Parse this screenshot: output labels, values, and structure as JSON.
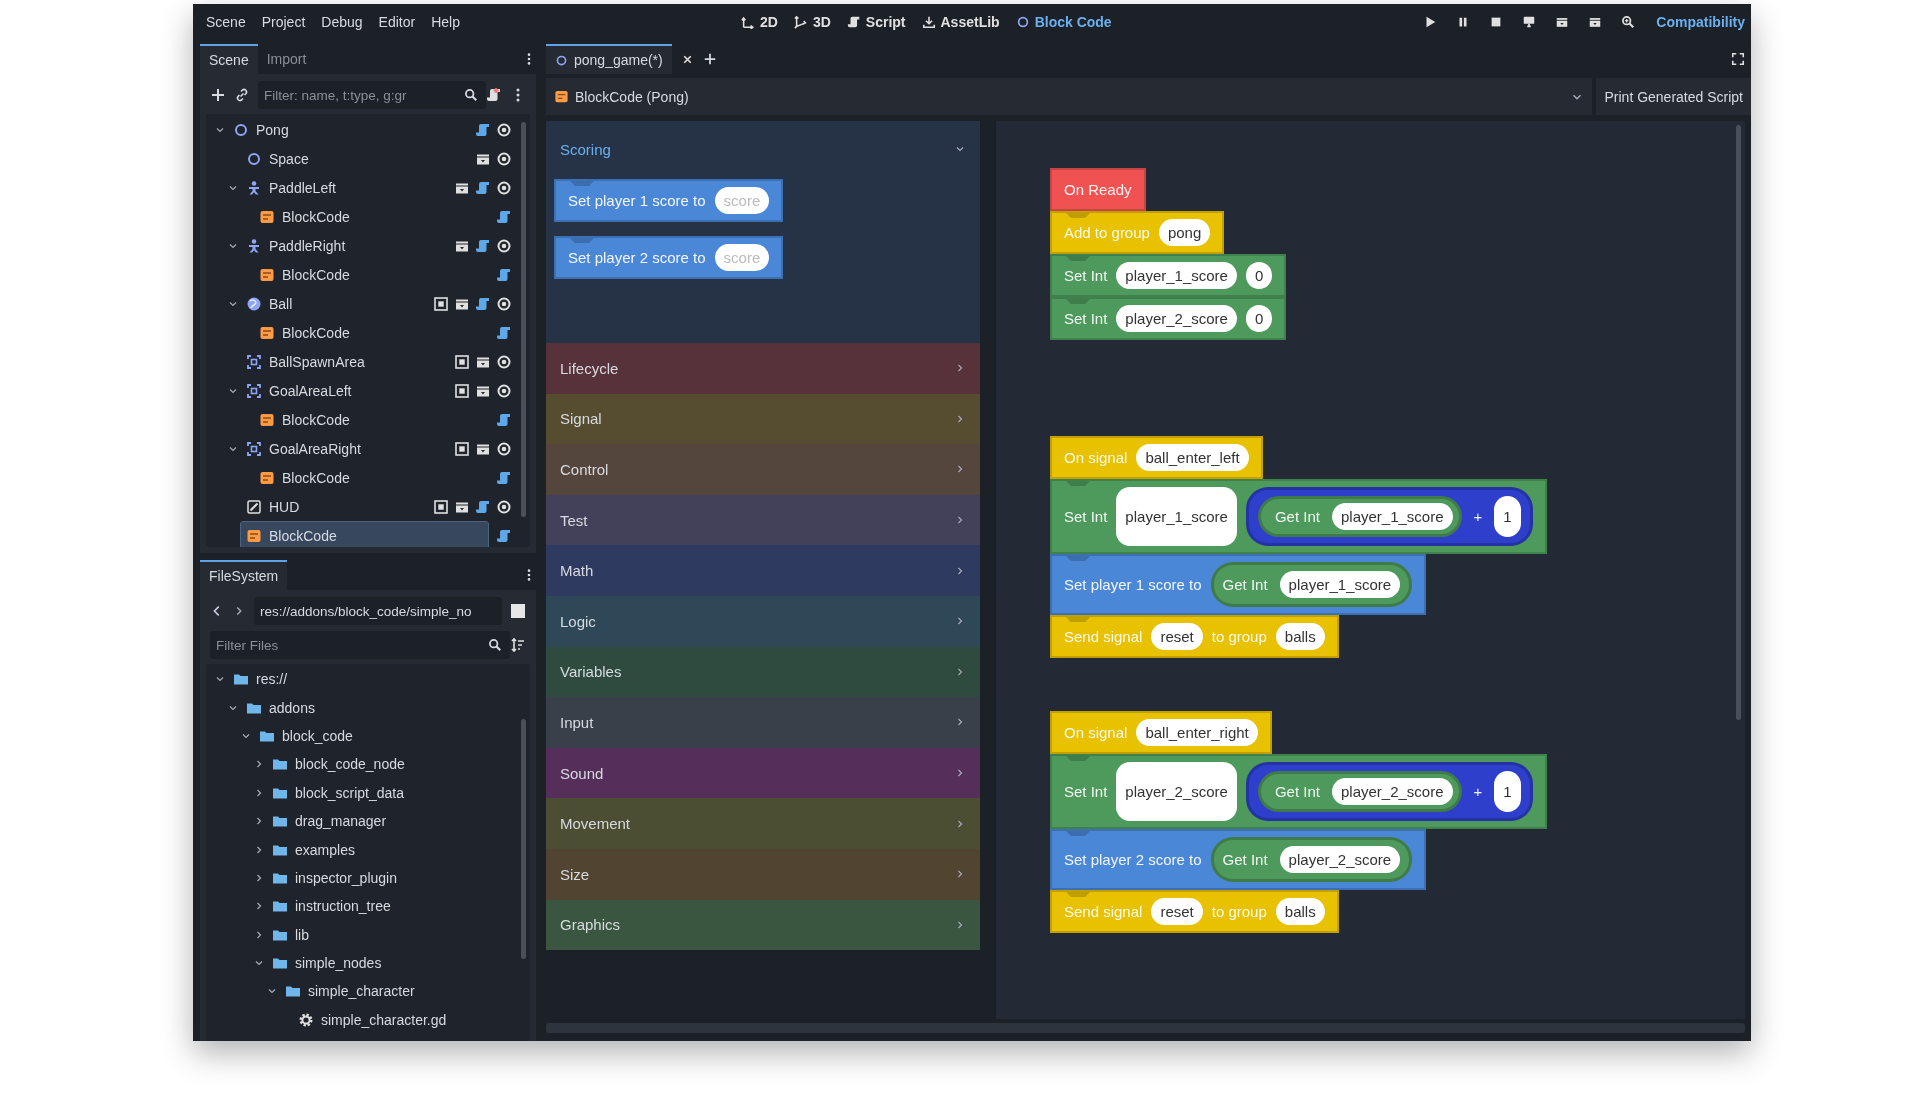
{
  "menu": [
    "Scene",
    "Project",
    "Debug",
    "Editor",
    "Help"
  ],
  "workspaces": [
    {
      "label": "2D",
      "selected": false
    },
    {
      "label": "3D",
      "selected": false
    },
    {
      "label": "Script",
      "selected": false
    },
    {
      "label": "AssetLib",
      "selected": false
    },
    {
      "label": "Block Code",
      "selected": true
    }
  ],
  "renderer": "Compatibility",
  "scene_dock": {
    "tabs": [
      {
        "label": "Scene",
        "selected": true
      },
      {
        "label": "Import",
        "selected": false
      }
    ],
    "filter": {
      "placeholder": "Filter: name, t:type, g:gr"
    },
    "tree": [
      {
        "name": "Pong",
        "kind": "node",
        "script": true,
        "visible": true,
        "expanded": true,
        "selected": false,
        "children": [
          {
            "name": "Space",
            "kind": "node",
            "groups": true,
            "visible": true,
            "selected": false
          },
          {
            "name": "PaddleLeft",
            "kind": "character",
            "groups": true,
            "script": true,
            "visible": true,
            "expanded": true,
            "selected": false,
            "children": [
              {
                "name": "BlockCode",
                "kind": "blockcode",
                "script": true,
                "selected": false
              }
            ]
          },
          {
            "name": "PaddleRight",
            "kind": "character",
            "groups": true,
            "script": true,
            "visible": true,
            "expanded": true,
            "selected": false,
            "children": [
              {
                "name": "BlockCode",
                "kind": "blockcode",
                "script": true,
                "selected": false
              }
            ]
          },
          {
            "name": "Ball",
            "kind": "rigidbody",
            "signals": true,
            "groups": true,
            "script": true,
            "visible": true,
            "expanded": true,
            "selected": false,
            "children": [
              {
                "name": "BlockCode",
                "kind": "blockcode",
                "script": true,
                "selected": false
              }
            ]
          },
          {
            "name": "BallSpawnArea",
            "kind": "area",
            "signals": true,
            "groups": true,
            "visible": true,
            "selected": false
          },
          {
            "name": "GoalAreaLeft",
            "kind": "area",
            "signals": true,
            "groups": true,
            "visible": true,
            "expanded": true,
            "selected": false,
            "children": [
              {
                "name": "BlockCode",
                "kind": "blockcode",
                "script": true,
                "selected": false
              }
            ]
          },
          {
            "name": "GoalAreaRight",
            "kind": "area",
            "signals": true,
            "groups": true,
            "visible": true,
            "expanded": true,
            "selected": false,
            "children": [
              {
                "name": "BlockCode",
                "kind": "blockcode",
                "script": true,
                "selected": false
              }
            ]
          },
          {
            "name": "HUD",
            "kind": "control",
            "signals": true,
            "groups": true,
            "script": true,
            "visible": true,
            "selected": false
          },
          {
            "name": "BlockCode",
            "kind": "blockcode",
            "script": true,
            "selected": true
          }
        ]
      }
    ]
  },
  "filesystem": {
    "tabs": [
      {
        "label": "FileSystem",
        "selected": true
      }
    ],
    "path": "res://addons/block_code/simple_no",
    "filter": {
      "placeholder": "Filter Files"
    },
    "tree": [
      {
        "name": "res://",
        "kind": "folder",
        "expanded": true,
        "children": [
          {
            "name": "addons",
            "kind": "folder",
            "expanded": true,
            "children": [
              {
                "name": "block_code",
                "kind": "folder",
                "expanded": true,
                "children": [
                  {
                    "name": "block_code_node",
                    "kind": "folder",
                    "expanded": false
                  },
                  {
                    "name": "block_script_data",
                    "kind": "folder",
                    "expanded": false
                  },
                  {
                    "name": "drag_manager",
                    "kind": "folder",
                    "expanded": false
                  },
                  {
                    "name": "examples",
                    "kind": "folder",
                    "expanded": false
                  },
                  {
                    "name": "inspector_plugin",
                    "kind": "folder",
                    "expanded": false
                  },
                  {
                    "name": "instruction_tree",
                    "kind": "folder",
                    "expanded": false
                  },
                  {
                    "name": "lib",
                    "kind": "folder",
                    "expanded": false
                  },
                  {
                    "name": "simple_nodes",
                    "kind": "folder",
                    "expanded": true,
                    "children": [
                      {
                        "name": "simple_character",
                        "kind": "folder",
                        "expanded": true,
                        "children": [
                          {
                            "name": "simple_character.gd",
                            "kind": "file"
                          }
                        ]
                      }
                    ]
                  }
                ]
              }
            ]
          }
        ]
      }
    ]
  },
  "editor": {
    "tabs": [
      {
        "label": "pong_game(*)",
        "selected": true
      }
    ],
    "node_selector": "BlockCode (Pong)",
    "print_button": "Print Generated Script",
    "palette": {
      "categories": [
        {
          "name": "Scoring",
          "color": "#263246",
          "expanded": true,
          "blocks": [
            {
              "kind": "statement",
              "color": "#4a87d6",
              "parts": [
                {
                  "kind": "text",
                  "text": "Set player 1 score to"
                },
                {
                  "kind": "value",
                  "placeholder": "score"
                }
              ]
            },
            {
              "kind": "statement",
              "color": "#4a87d6",
              "parts": [
                {
                  "kind": "text",
                  "text": "Set player 2 score to"
                },
                {
                  "kind": "value",
                  "placeholder": "score"
                }
              ]
            }
          ]
        },
        {
          "name": "Lifecycle",
          "color": "#58323a",
          "expanded": false
        },
        {
          "name": "Signal",
          "color": "#564c30",
          "expanded": false
        },
        {
          "name": "Control",
          "color": "#54453d",
          "expanded": false
        },
        {
          "name": "Test",
          "color": "#43415a",
          "expanded": false
        },
        {
          "name": "Math",
          "color": "#2e3a60",
          "expanded": false
        },
        {
          "name": "Logic",
          "color": "#2e4857",
          "expanded": false
        },
        {
          "name": "Variables",
          "color": "#2f4a3e",
          "expanded": false
        },
        {
          "name": "Input",
          "color": "#3a4049",
          "expanded": false
        },
        {
          "name": "Sound",
          "color": "#552f5a",
          "expanded": false
        },
        {
          "name": "Movement",
          "color": "#4b4e32",
          "expanded": false
        },
        {
          "name": "Size",
          "color": "#514532",
          "expanded": false
        },
        {
          "name": "Graphics",
          "color": "#3a5640",
          "expanded": false
        }
      ]
    },
    "canvas": {
      "stacks": [
        {
          "blocks": [
            {
              "kind": "hat",
              "color": "#f05252",
              "parts": [
                {
                  "kind": "text",
                  "text": "On Ready"
                }
              ]
            },
            {
              "kind": "statement",
              "color": "#e8c100",
              "parts": [
                {
                  "kind": "text",
                  "text": "Add to group"
                },
                {
                  "kind": "value",
                  "text": "pong"
                }
              ]
            },
            {
              "kind": "statement",
              "color": "#4e9a5c",
              "parts": [
                {
                  "kind": "text",
                  "text": "Set Int"
                },
                {
                  "kind": "value",
                  "text": "player_1_score"
                },
                {
                  "kind": "value",
                  "text": "0"
                }
              ]
            },
            {
              "kind": "statement",
              "color": "#4e9a5c",
              "parts": [
                {
                  "kind": "text",
                  "text": "Set Int"
                },
                {
                  "kind": "value",
                  "text": "player_2_score"
                },
                {
                  "kind": "value",
                  "text": "0"
                }
              ]
            }
          ]
        },
        {
          "blocks": [
            {
              "kind": "hat",
              "color": "#e8c100",
              "parts": [
                {
                  "kind": "text",
                  "text": "On signal"
                },
                {
                  "kind": "value",
                  "text": "ball_enter_left"
                }
              ]
            },
            {
              "kind": "statement",
              "color": "#4e9a5c",
              "parts": [
                {
                  "kind": "text",
                  "text": "Set Int"
                },
                {
                  "kind": "value",
                  "text": "player_1_score"
                },
                {
                  "kind": "expr",
                  "color": "#2e3fcc",
                  "parts": [
                    {
                      "kind": "expr",
                      "color": "#4e9a5c",
                      "parts": [
                        {
                          "kind": "text",
                          "text": "Get Int"
                        },
                        {
                          "kind": "value",
                          "text": "player_1_score"
                        }
                      ]
                    },
                    {
                      "kind": "text",
                      "text": "+"
                    },
                    {
                      "kind": "value",
                      "text": "1"
                    }
                  ]
                }
              ]
            },
            {
              "kind": "statement",
              "color": "#4a87d6",
              "parts": [
                {
                  "kind": "text",
                  "text": "Set player 1 score to"
                },
                {
                  "kind": "expr",
                  "color": "#4e9a5c",
                  "parts": [
                    {
                      "kind": "text",
                      "text": "Get Int"
                    },
                    {
                      "kind": "value",
                      "text": "player_1_score"
                    }
                  ]
                }
              ]
            },
            {
              "kind": "statement",
              "color": "#e8c100",
              "parts": [
                {
                  "kind": "text",
                  "text": "Send signal"
                },
                {
                  "kind": "value",
                  "text": "reset"
                },
                {
                  "kind": "text",
                  "text": "to group"
                },
                {
                  "kind": "value",
                  "text": "balls"
                }
              ]
            }
          ]
        },
        {
          "blocks": [
            {
              "kind": "hat",
              "color": "#e8c100",
              "parts": [
                {
                  "kind": "text",
                  "text": "On signal"
                },
                {
                  "kind": "value",
                  "text": "ball_enter_right"
                }
              ]
            },
            {
              "kind": "statement",
              "color": "#4e9a5c",
              "parts": [
                {
                  "kind": "text",
                  "text": "Set Int"
                },
                {
                  "kind": "value",
                  "text": "player_2_score"
                },
                {
                  "kind": "expr",
                  "color": "#2e3fcc",
                  "parts": [
                    {
                      "kind": "expr",
                      "color": "#4e9a5c",
                      "parts": [
                        {
                          "kind": "text",
                          "text": "Get Int"
                        },
                        {
                          "kind": "value",
                          "text": "player_2_score"
                        }
                      ]
                    },
                    {
                      "kind": "text",
                      "text": "+"
                    },
                    {
                      "kind": "value",
                      "text": "1"
                    }
                  ]
                }
              ]
            },
            {
              "kind": "statement",
              "color": "#4a87d6",
              "parts": [
                {
                  "kind": "text",
                  "text": "Set player 2 score to"
                },
                {
                  "kind": "expr",
                  "color": "#4e9a5c",
                  "parts": [
                    {
                      "kind": "text",
                      "text": "Get Int"
                    },
                    {
                      "kind": "value",
                      "text": "player_2_score"
                    }
                  ]
                }
              ]
            },
            {
              "kind": "statement",
              "color": "#e8c100",
              "parts": [
                {
                  "kind": "text",
                  "text": "Send signal"
                },
                {
                  "kind": "value",
                  "text": "reset"
                },
                {
                  "kind": "text",
                  "text": "to group"
                },
                {
                  "kind": "value",
                  "text": "balls"
                }
              ]
            }
          ]
        }
      ]
    }
  }
}
